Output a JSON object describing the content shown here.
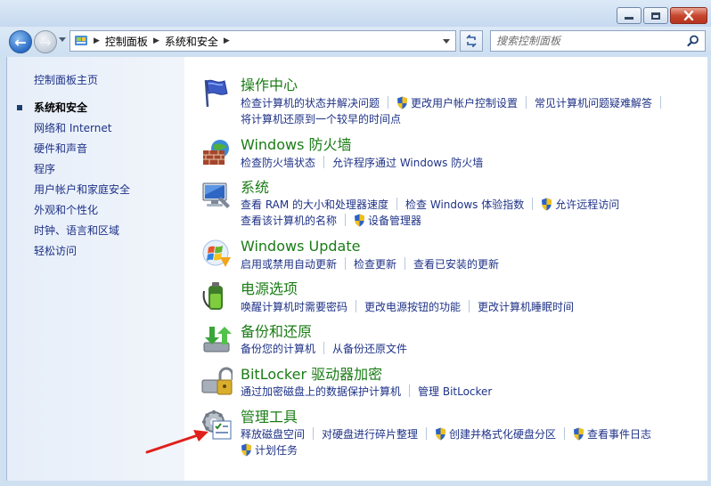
{
  "window": {
    "controls": [
      "minimize-icon",
      "maximize-icon",
      "close-icon"
    ]
  },
  "nav": {
    "breadcrumb": [
      "控制面板",
      "系统和安全"
    ],
    "search_placeholder": "搜索控制面板"
  },
  "sidebar": {
    "home": "控制面板主页",
    "items": [
      {
        "label": "系统和安全",
        "active": true
      },
      {
        "label": "网络和 Internet"
      },
      {
        "label": "硬件和声音"
      },
      {
        "label": "程序"
      },
      {
        "label": "用户帐户和家庭安全"
      },
      {
        "label": "外观和个性化"
      },
      {
        "label": "时钟、语言和区域"
      },
      {
        "label": "轻松访问"
      }
    ]
  },
  "categories": [
    {
      "title": "操作中心",
      "icon": "action-center-flag-icon",
      "links": [
        "检查计算机的状态并解决问题",
        "更改用户帐户控制设置",
        "常见计算机问题疑难解答",
        "将计算机还原到一个较早的时间点"
      ]
    },
    {
      "title": "Windows 防火墙",
      "icon": "firewall-icon",
      "links": [
        "检查防火墙状态",
        "允许程序通过 Windows 防火墙"
      ]
    },
    {
      "title": "系统",
      "icon": "system-computer-icon",
      "links": [
        "查看 RAM 的大小和处理器速度",
        "检查 Windows 体验指数",
        "允许远程访问",
        "查看该计算机的名称",
        "设备管理器"
      ]
    },
    {
      "title": "Windows Update",
      "icon": "windows-update-icon",
      "links": [
        "启用或禁用自动更新",
        "检查更新",
        "查看已安装的更新"
      ]
    },
    {
      "title": "电源选项",
      "icon": "power-options-icon",
      "links": [
        "唤醒计算机时需要密码",
        "更改电源按钮的功能",
        "更改计算机睡眠时间"
      ]
    },
    {
      "title": "备份和还原",
      "icon": "backup-restore-icon",
      "links": [
        "备份您的计算机",
        "从备份还原文件"
      ]
    },
    {
      "title": "BitLocker 驱动器加密",
      "icon": "bitlocker-icon",
      "links": [
        "通过加密磁盘上的数据保护计算机",
        "管理 BitLocker"
      ]
    },
    {
      "title": "管理工具",
      "icon": "administrative-tools-icon",
      "links": [
        "释放磁盘空间",
        "对硬盘进行碎片整理",
        "创建并格式化硬盘分区",
        "查看事件日志",
        "计划任务"
      ]
    }
  ],
  "colors": {
    "category_title": "#1a7c15",
    "link": "#1e3287",
    "annotation_arrow": "#e0201b"
  }
}
